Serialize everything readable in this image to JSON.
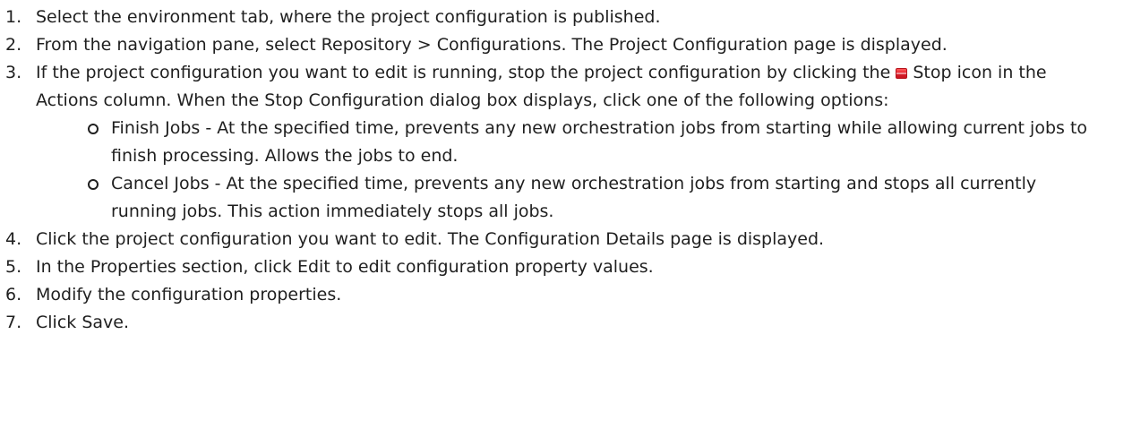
{
  "steps": [
    {
      "num": "1.",
      "text": "Select the environment tab, where the project configuration is published."
    },
    {
      "num": "2.",
      "text": "From the navigation pane, select Repository > Configurations. The Project Configuration page is displayed."
    },
    {
      "num": "3.",
      "text_before": "If the project configuration you want to edit is running, stop the project configuration by clicking the",
      "icon": "stop-icon",
      "text_after": "Stop icon in the Actions column. When the Stop Configuration dialog box displays, click one of the following options:"
    },
    {
      "num": "4.",
      "text": "Click the project configuration you want to edit. The Configuration Details page is displayed."
    },
    {
      "num": "5.",
      "text": "In the Properties section, click Edit to edit configuration property values."
    },
    {
      "num": "6.",
      "text": "Modify the configuration properties."
    },
    {
      "num": "7.",
      "text": "Click Save."
    }
  ],
  "options": [
    {
      "text": "Finish Jobs - At the specified time, prevents any new orchestration jobs from starting while allowing current jobs to finish processing. Allows the jobs to end."
    },
    {
      "text": "Cancel Jobs - At the specified time, prevents any new orchestration jobs from starting and stops all currently running jobs. This action immediately stops all jobs."
    }
  ],
  "colors": {
    "text": "#1f1f1f",
    "stop_icon": "#e8232f"
  }
}
